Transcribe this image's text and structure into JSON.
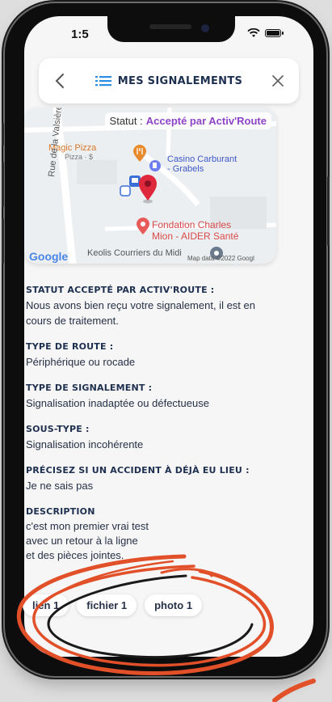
{
  "status_bar": {
    "time": "1:5"
  },
  "header": {
    "title": "MES SIGNALEMENTS"
  },
  "map": {
    "status_label": "Statut :",
    "status_value": "Accepté par Activ'Route",
    "places": {
      "magic_pizza": "Magic Pizza",
      "magic_pizza_sub": "Pizza · $",
      "casino": "Casino Carburant",
      "casino_sub": "- Grabels",
      "street": "Rue de la Valsière",
      "fondation": "Fondation Charles",
      "fondation_sub": "Mion - AIDER Santé",
      "keolis": "Keolis Courriers du Midi",
      "google": "Google",
      "map_data": "Map data ©2022 Googl"
    }
  },
  "details": {
    "statut": {
      "label": "STATUT ACCEPTÉ PAR ACTIV'ROUTE :",
      "value": "Nous avons bien reçu votre signalement, il est en cours de traitement."
    },
    "route": {
      "label": "TYPE DE ROUTE :",
      "value": "Périphérique ou rocade"
    },
    "signalement": {
      "label": "TYPE DE SIGNALEMENT :",
      "value": "Signalisation inadaptée ou défectueuse"
    },
    "sous_type": {
      "label": "SOUS-TYPE :",
      "value": "Signalisation incohérente"
    },
    "accident": {
      "label": "PRÉCISEZ SI UN ACCIDENT À DÉJÀ EU LIEU :",
      "value": "Je ne sais pas"
    },
    "description": {
      "label": "DESCRIPTION",
      "lines": [
        "c'est mon premier vrai test",
        "avec un retour à la ligne",
        "et des pièces jointes."
      ]
    }
  },
  "attachments": [
    "lien 1",
    "fichier 1",
    "photo 1"
  ],
  "colors": {
    "accent": "#1e3050",
    "status": "#8e44c9",
    "pin": "#e0283c",
    "scribble": "#e2502a"
  }
}
